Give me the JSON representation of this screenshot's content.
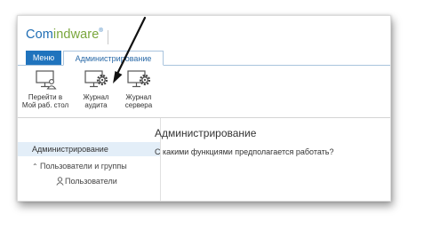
{
  "app": {
    "logo_part1": "Com",
    "logo_part2": "indware",
    "logo_reg": "®"
  },
  "tabs": [
    {
      "label": "Меню",
      "active": false
    },
    {
      "label": "Администрирование",
      "active": true
    }
  ],
  "ribbon": {
    "buttons": [
      {
        "label_line1": "Перейти в",
        "label_line2": "Мой раб. стол",
        "icon": "monitor-user-icon"
      },
      {
        "label_line1": "Журнал",
        "label_line2": "аудита",
        "icon": "monitor-gear-icon"
      },
      {
        "label_line1": "Журнал",
        "label_line2": "сервера",
        "icon": "monitor-gear-icon"
      }
    ]
  },
  "sidebar": {
    "items": [
      {
        "label": "Администрирование",
        "selected": true
      },
      {
        "label": "Пользователи и группы",
        "expanded": true
      },
      {
        "label": "Пользователи",
        "icon": "user-icon"
      }
    ]
  },
  "main": {
    "title": "Администрирование",
    "question": "С какими функциями предполагается работать?"
  },
  "colors": {
    "brand_blue": "#1e6db4",
    "brand_green": "#7aa63c",
    "active_tab": "#1f73bd",
    "selected_item": "#e3eef8"
  }
}
